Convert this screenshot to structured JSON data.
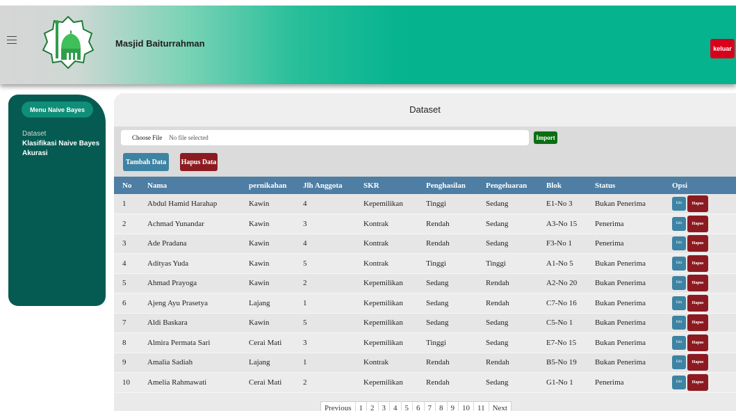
{
  "header": {
    "title": "Masjid Baiturrahman",
    "logout_label": "keluar",
    "menu_icon": "hamburger-icon",
    "logo_icon": "mosque-logo-icon"
  },
  "sidebar": {
    "heading": "Menu Naive Bayes",
    "items": [
      {
        "label": "Dataset"
      },
      {
        "label": "Klasifikasi Naive Bayes"
      },
      {
        "label": "Akurasi"
      }
    ]
  },
  "main": {
    "title": "Dataset",
    "file_button": "Choose File",
    "file_status": "No file selected",
    "import_label": "Import",
    "add_label": "Tambah Data",
    "delete_all_label": "Hapus Data"
  },
  "table": {
    "headers": [
      "No",
      "Nama",
      "pernikahan",
      "Jlh Anggota",
      "SKR",
      "Penghasilan",
      "Pengeluaran",
      "Blok",
      "Status",
      "Opsi"
    ],
    "edit_label": "Edit",
    "delete_label": "Hapus",
    "rows": [
      {
        "no": "1",
        "nama": "Abdul Hamid Harahap",
        "pernikahan": "Kawin",
        "jlh": "4",
        "skr": "Kepemilikan",
        "penghasilan": "Tinggi",
        "pengeluaran": "Sedang",
        "blok": "E1-No 3",
        "status": "Bukan Penerima"
      },
      {
        "no": "2",
        "nama": "Achmad Yunandar",
        "pernikahan": "Kawin",
        "jlh": "3",
        "skr": "Kontrak",
        "penghasilan": "Rendah",
        "pengeluaran": "Sedang",
        "blok": "A3-No 15",
        "status": "Penerima"
      },
      {
        "no": "3",
        "nama": "Ade Pradana",
        "pernikahan": "Kawin",
        "jlh": "4",
        "skr": "Kontrak",
        "penghasilan": "Rendah",
        "pengeluaran": "Sedang",
        "blok": "F3-No 1",
        "status": "Penerima"
      },
      {
        "no": "4",
        "nama": "Adityas Yuda",
        "pernikahan": "Kawin",
        "jlh": "5",
        "skr": "Kontrak",
        "penghasilan": "Tinggi",
        "pengeluaran": "Tinggi",
        "blok": "A1-No 5",
        "status": "Bukan Penerima"
      },
      {
        "no": "5",
        "nama": "Ahmad Prayoga",
        "pernikahan": "Kawin",
        "jlh": "2",
        "skr": "Kepemilikan",
        "penghasilan": "Sedang",
        "pengeluaran": "Rendah",
        "blok": "A2-No 20",
        "status": "Bukan Penerima"
      },
      {
        "no": "6",
        "nama": "Ajeng Ayu Prasetya",
        "pernikahan": "Lajang",
        "jlh": "1",
        "skr": "Kepemilikan",
        "penghasilan": "Sedang",
        "pengeluaran": "Rendah",
        "blok": "C7-No 16",
        "status": "Bukan Penerima"
      },
      {
        "no": "7",
        "nama": "Aldi Baskara",
        "pernikahan": "Kawin",
        "jlh": "5",
        "skr": "Kepemilikan",
        "penghasilan": "Sedang",
        "pengeluaran": "Sedang",
        "blok": "C5-No 1",
        "status": "Bukan Penerima"
      },
      {
        "no": "8",
        "nama": "Almira Permata Sari",
        "pernikahan": "Cerai Mati",
        "jlh": "3",
        "skr": "Kepemilikan",
        "penghasilan": "Tinggi",
        "pengeluaran": "Sedang",
        "blok": "E7-No 15",
        "status": "Bukan Penerima"
      },
      {
        "no": "9",
        "nama": "Amalia Sadiah",
        "pernikahan": "Lajang",
        "jlh": "1",
        "skr": "Kontrak",
        "penghasilan": "Rendah",
        "pengeluaran": "Rendah",
        "blok": "B5-No 19",
        "status": "Bukan Penerima"
      },
      {
        "no": "10",
        "nama": "Amelia Rahmawati",
        "pernikahan": "Cerai Mati",
        "jlh": "2",
        "skr": "Kepemilikan",
        "penghasilan": "Rendah",
        "pengeluaran": "Sedang",
        "blok": "G1-No 1",
        "status": "Penerima"
      }
    ]
  },
  "pagination": {
    "previous": "Previous",
    "pages": [
      "1",
      "2",
      "3",
      "4",
      "5",
      "6",
      "7",
      "8",
      "9",
      "10",
      "11"
    ],
    "next": "Next"
  },
  "colors": {
    "header_accent": "#05b38f",
    "sidebar_bg": "#055b51",
    "table_header": "#4e7ea4",
    "edit_button": "#3e83a3",
    "delete_button": "#8c1b21",
    "import_button": "#0b6e12",
    "logout_button": "#d9001b"
  }
}
